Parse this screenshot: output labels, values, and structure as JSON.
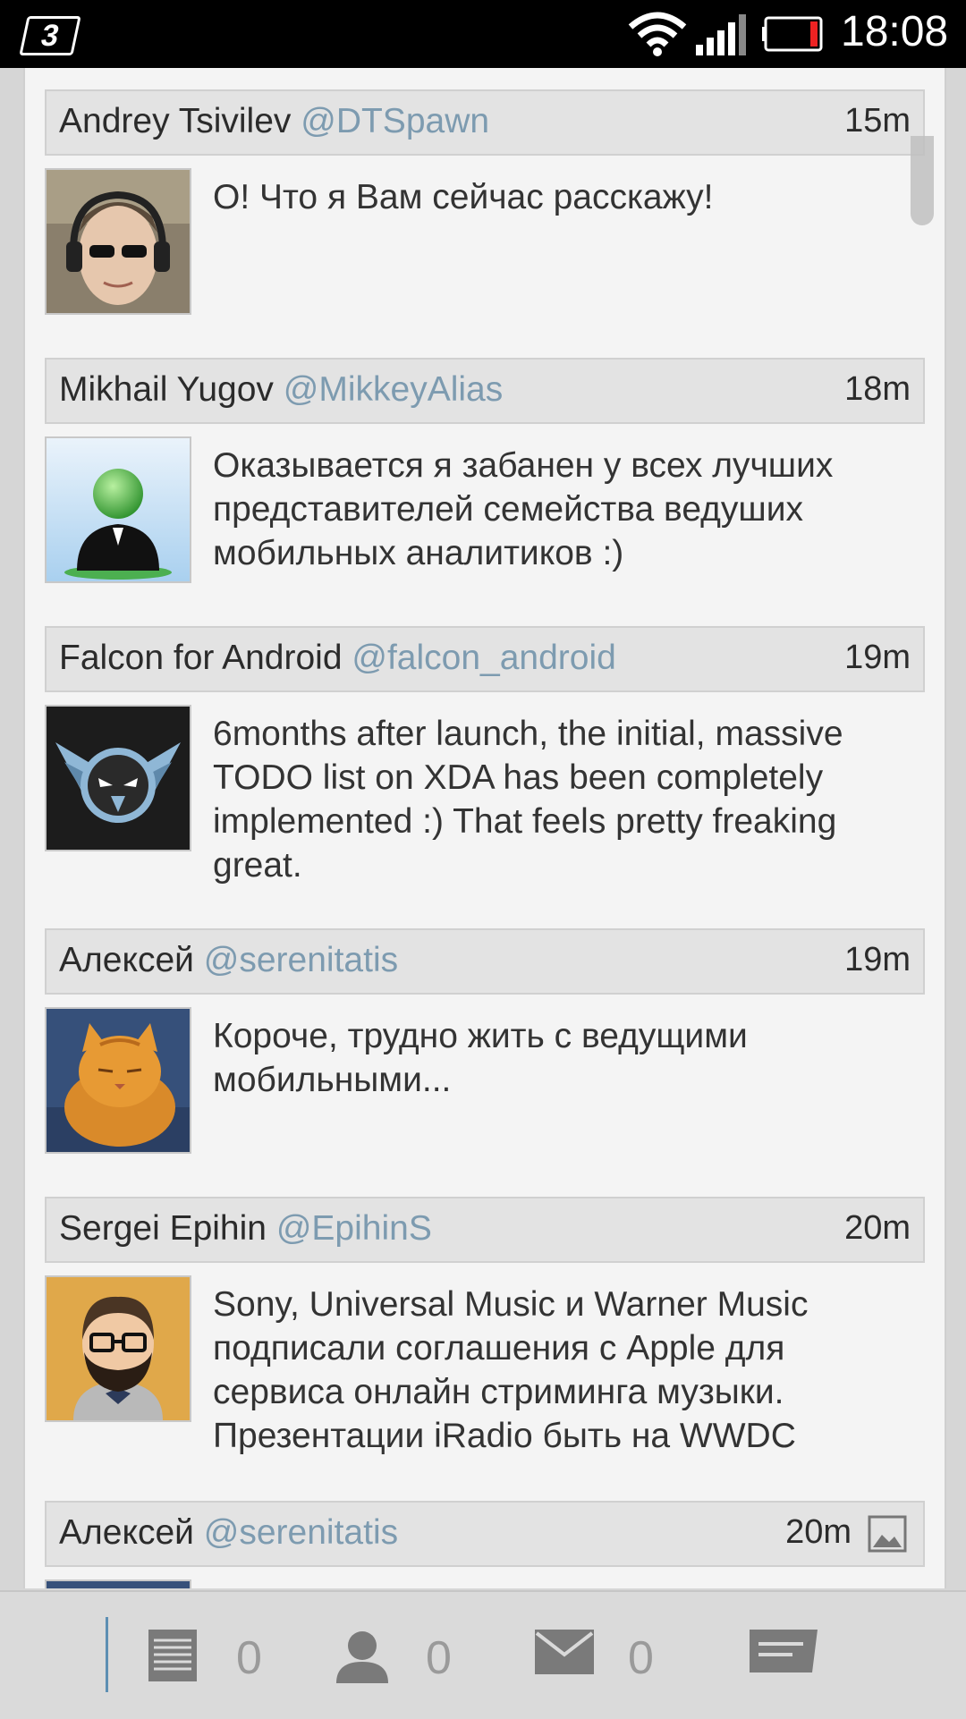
{
  "status_bar": {
    "carrier_logo": "3",
    "time": "18:08",
    "icons": [
      "wifi-icon",
      "signal-icon",
      "battery-low-icon"
    ]
  },
  "tweets": [
    {
      "name": "Andrey Tsivilev",
      "handle": "@DTSpawn",
      "time": "15m",
      "text": "О! Что я Вам сейчас расскажу!",
      "avatar": "person-headphones-avatar"
    },
    {
      "name": "Mikhail Yugov",
      "handle": "@MikkeyAlias",
      "time": "18m",
      "text": "Оказывается я забанен у всех лучших представителей семейства ведуших мобильных аналитиков :)",
      "avatar": "green-person-avatar"
    },
    {
      "name": "Falcon for Android",
      "handle": "@falcon_android",
      "time": "19m",
      "text": "6months after launch, the initial, massive TODO list on XDA has been completely implemented :) That feels pretty freaking great.",
      "avatar": "falcon-logo-avatar"
    },
    {
      "name": "Алексей",
      "handle": "@serenitatis",
      "time": "19m",
      "text": "Короче, трудно жить с ведущими мобильными...",
      "avatar": "cat-avatar"
    },
    {
      "name": "Sergei Epihin",
      "handle": "@EpihinS",
      "time": "20m",
      "text": "Sony, Universal Music и Warner Music подписали соглашения с Apple для сервиса онлайн стриминга музыки. Презентации iRadio быть на WWDC",
      "avatar": "bearded-man-avatar"
    },
    {
      "name": "Алексей",
      "handle": "@serenitatis",
      "time": "20m",
      "text": "",
      "avatar": "cat-avatar",
      "has_media": true
    }
  ],
  "bottom_bar": {
    "timeline_count": "0",
    "mentions_count": "0",
    "messages_count": "0",
    "icons": [
      "timeline-icon",
      "mentions-icon",
      "messages-icon",
      "compose-icon"
    ]
  },
  "colors": {
    "handle": "#7d9bb0",
    "accent": "#5d8fb3",
    "header_bg": "#e3e3e3",
    "timeline_bg": "#f4f4f4"
  }
}
